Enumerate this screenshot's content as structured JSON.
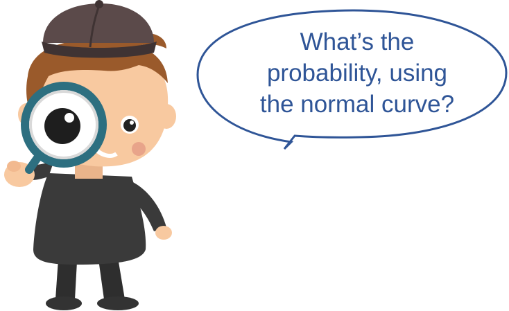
{
  "speech_bubble": {
    "lines": [
      "What’s the",
      "probability, using",
      "the normal curve?"
    ]
  },
  "colors": {
    "bubble_border": "#2f5597",
    "bubble_text": "#2f5597",
    "hat": "#5b4a4a",
    "hair": "#9a5a2b",
    "skin": "#f8c9a0",
    "coat": "#3a3a3a",
    "magnifier_ring": "#2d6f80"
  },
  "icons": {
    "character": "detective-character-icon",
    "magnifier": "magnifying-glass-icon"
  }
}
